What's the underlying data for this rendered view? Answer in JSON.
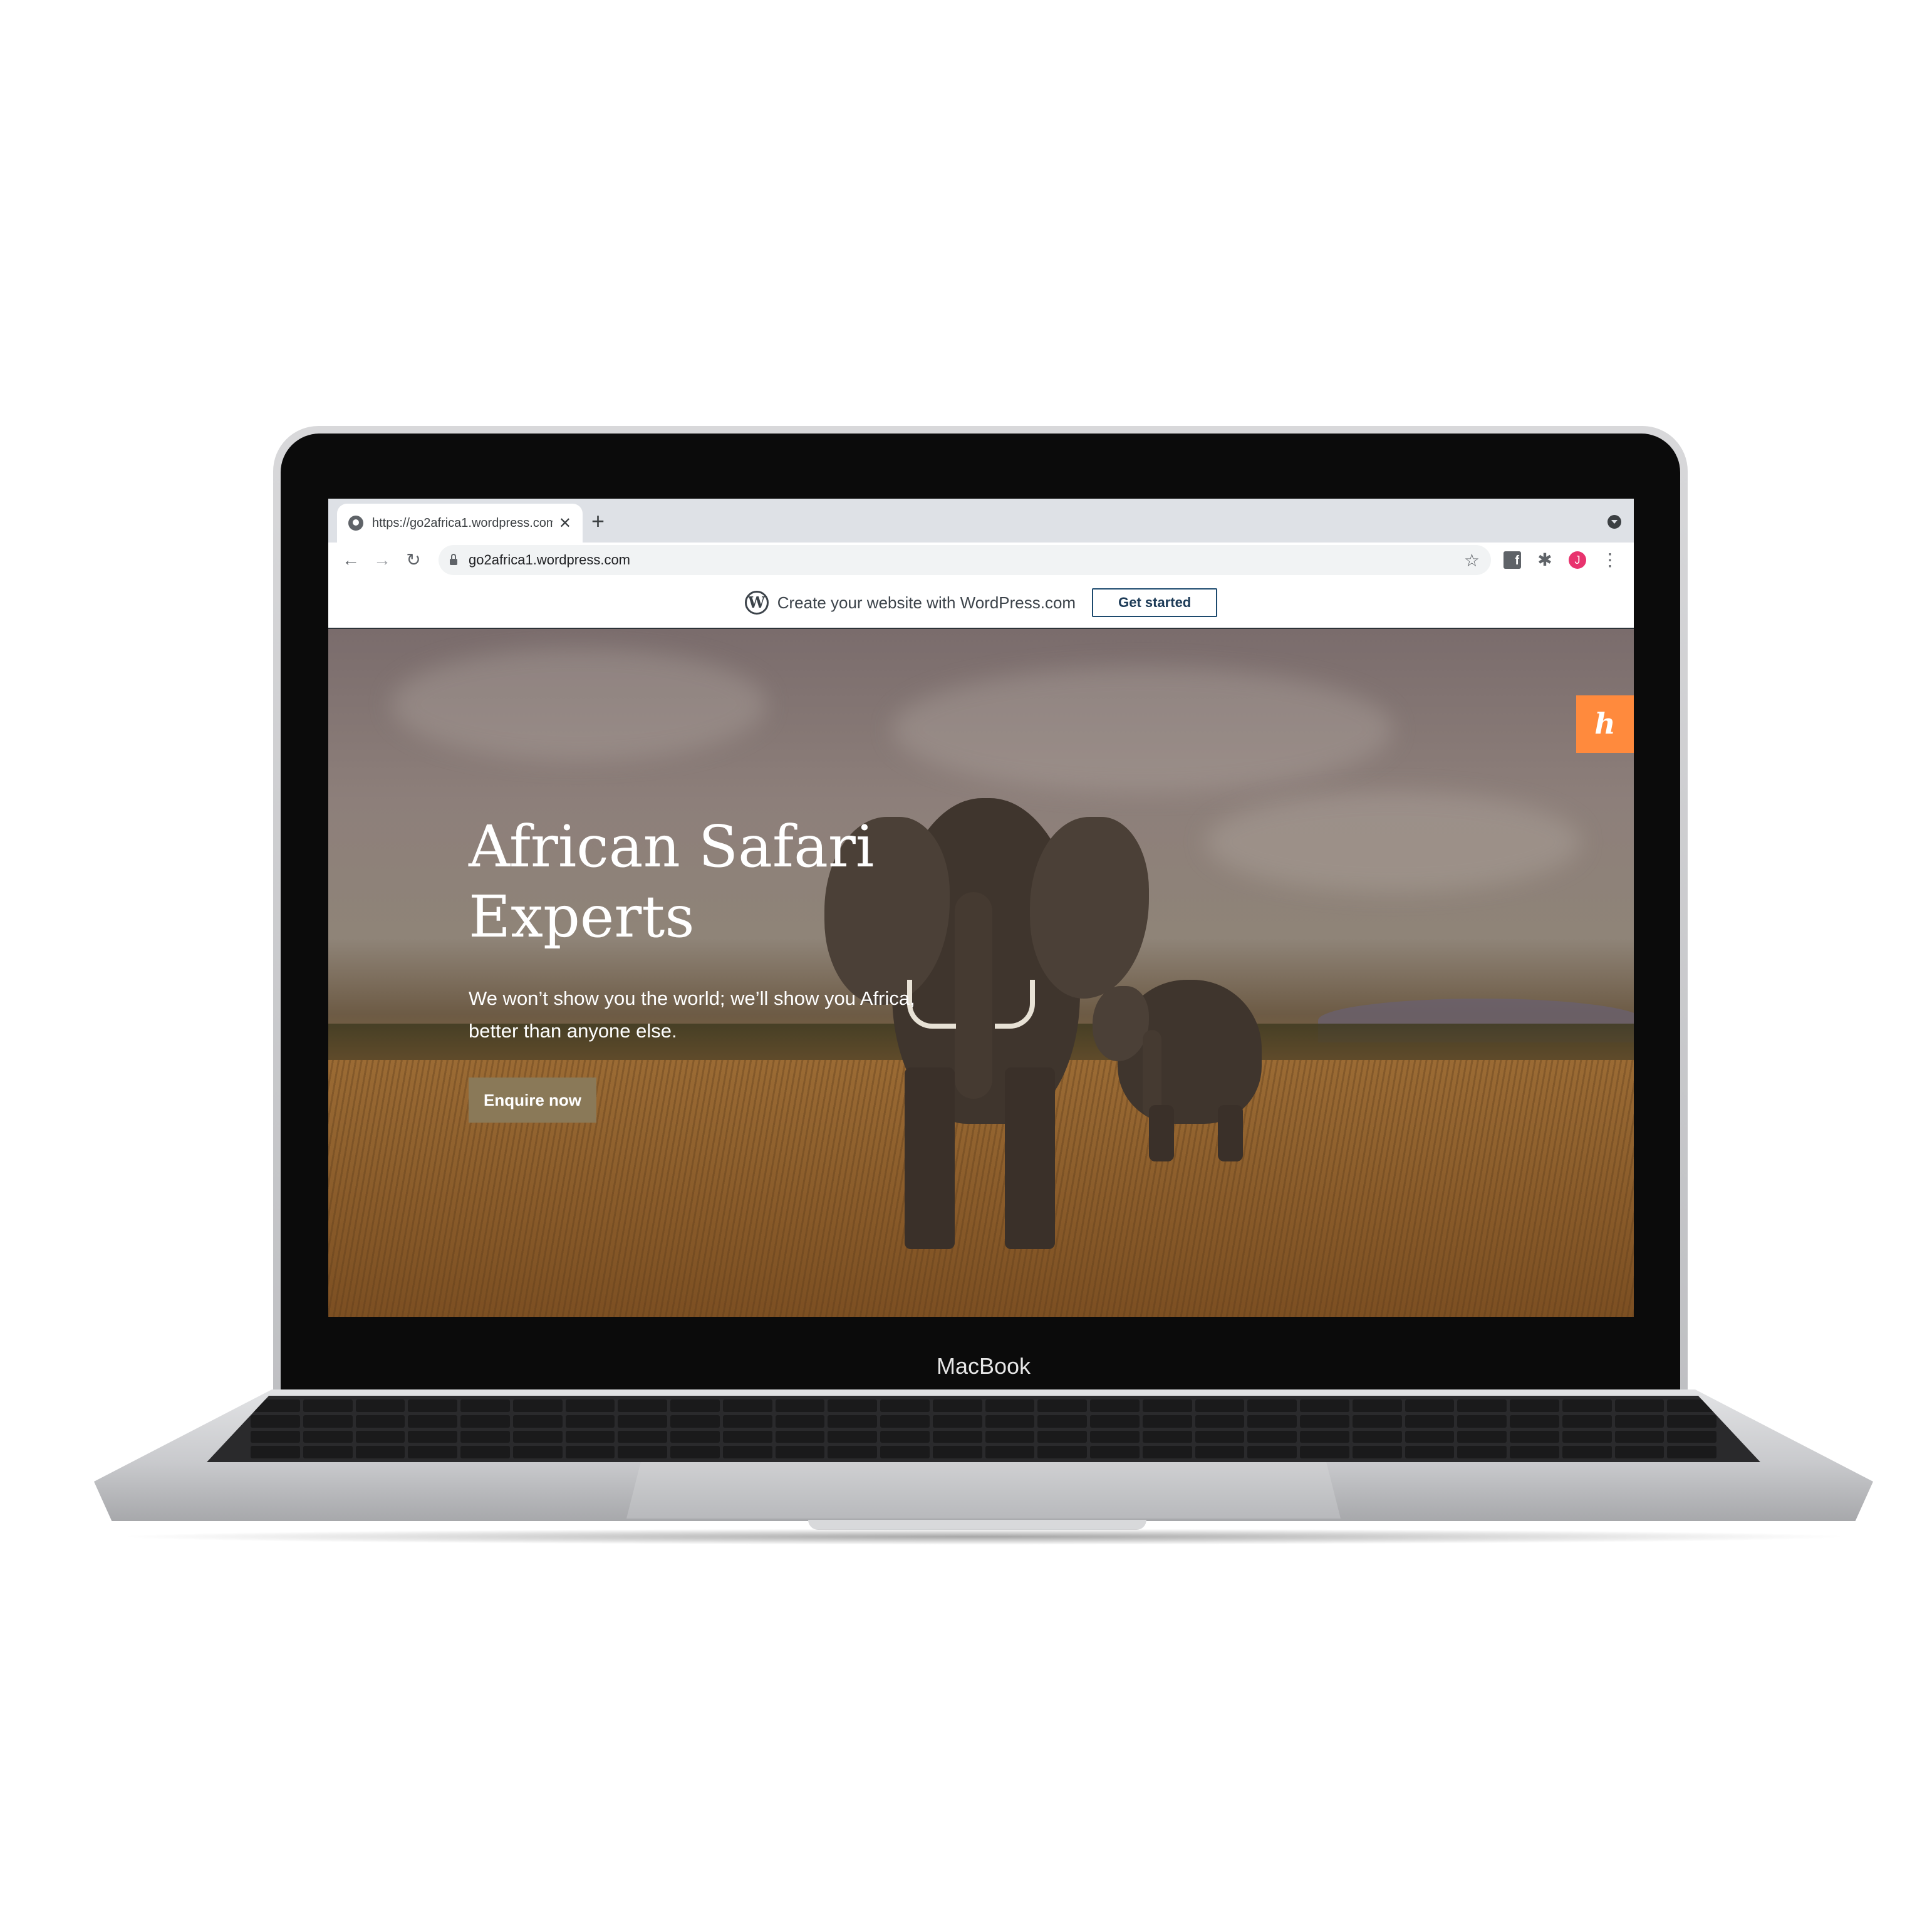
{
  "device": {
    "brand_label": "MacBook"
  },
  "browser": {
    "tab": {
      "title": "https://go2africa1.wordpress.com",
      "close_glyph": "✕"
    },
    "new_tab_glyph": "+",
    "toolbar": {
      "back_glyph": "←",
      "forward_glyph": "→",
      "reload_glyph": "↻",
      "url": "go2africa1.wordpress.com",
      "bookmark_glyph": "☆",
      "extensions": {
        "facebook_glyph": "f",
        "puzzle_glyph": "✱",
        "profile_initial": "J",
        "menu_glyph": "⋮"
      }
    }
  },
  "wp_banner": {
    "logo_letter": "W",
    "text": "Create your website with WordPress.com",
    "button_label": "Get started"
  },
  "hero": {
    "title_line1": "African Safari",
    "title_line2": "Experts",
    "subtitle_line1": "We won’t show you the world; we’ll show you Africa,",
    "subtitle_line2": "better than anyone else.",
    "button_label": "Enquire now",
    "side_widget_letter": "h"
  },
  "colors": {
    "hero_button": "#8a7958",
    "side_widget": "#ff8a3d",
    "profile_avatar": "#e8336e",
    "wp_button_border": "#1d4a6e"
  }
}
